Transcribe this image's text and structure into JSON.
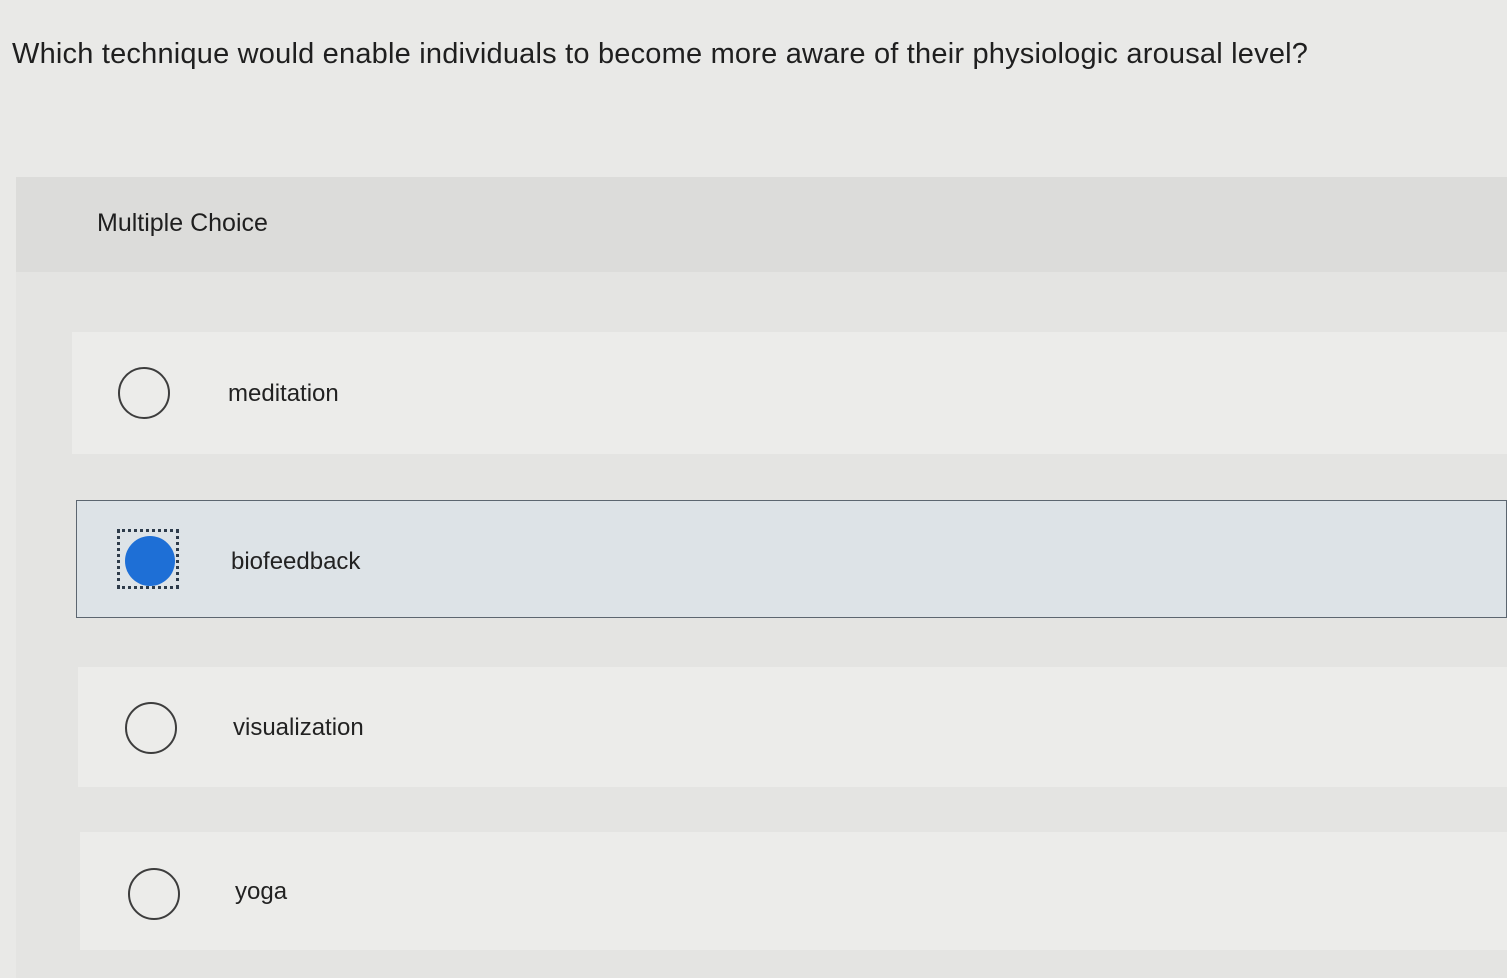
{
  "question": {
    "text": "Which technique would enable individuals to become more aware of their physiologic arousal level?"
  },
  "multiple_choice": {
    "heading": "Multiple Choice",
    "selected_index": 1,
    "options": [
      {
        "label": "meditation",
        "selected": false
      },
      {
        "label": "biofeedback",
        "selected": true
      },
      {
        "label": "visualization",
        "selected": false
      },
      {
        "label": "yoga",
        "selected": false
      }
    ]
  },
  "colors": {
    "selected_radio": "#1e6fd6",
    "selected_option_bg": "#dde3e7",
    "page_bg": "#e9e9e7"
  }
}
